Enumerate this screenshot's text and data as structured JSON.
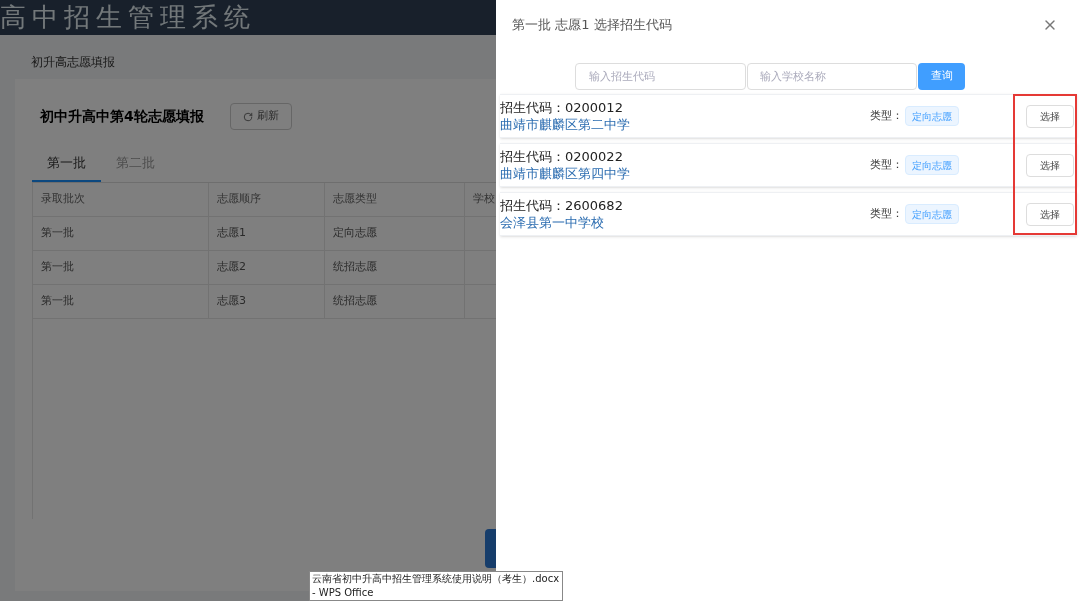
{
  "header": {
    "title": "高中招生管理系统"
  },
  "breadcrumb": "初升高志愿填报",
  "card": {
    "title": "初中升高中第4轮志愿填报",
    "refresh_button": "刷新"
  },
  "tabs": [
    {
      "label": "第一批",
      "selected": true
    },
    {
      "label": "第二批",
      "selected": false
    }
  ],
  "table": {
    "columns": [
      "录取批次",
      "志愿顺序",
      "志愿类型",
      "学校"
    ],
    "rows": [
      [
        "第一批",
        "志愿1",
        "定向志愿"
      ],
      [
        "第一批",
        "志愿2",
        "统招志愿"
      ],
      [
        "第一批",
        "志愿3",
        "统招志愿"
      ]
    ]
  },
  "drawer": {
    "title": "第一批 志愿1 选择招生代码",
    "code_placeholder": "输入招生代码",
    "name_placeholder": "输入学校名称",
    "search_button": "查询",
    "results": [
      {
        "code": "招生代码：0200012",
        "school": "曲靖市麒麟区第二中学",
        "type_label": "类型：",
        "type": "定向志愿",
        "select_button": "选择"
      },
      {
        "code": "招生代码：0200022",
        "school": "曲靖市麒麟区第四中学",
        "type_label": "类型：",
        "type": "定向志愿",
        "select_button": "选择"
      },
      {
        "code": "招生代码：2600682",
        "school": "会泽县第一中学校",
        "type_label": "类型：",
        "type": "定向志愿",
        "select_button": "选择"
      }
    ]
  },
  "tooltip": "云南省初中升高中招生管理系统使用说明（考生）.docx - WPS Office"
}
